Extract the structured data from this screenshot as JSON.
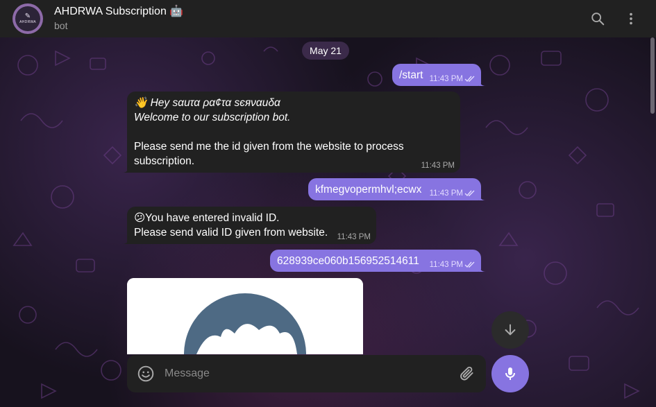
{
  "header": {
    "avatar_text": "AHDRWA",
    "title": "AHDRWA Subscription 🤖",
    "subtitle": "bot",
    "search_icon": "search-icon",
    "menu_icon": "more-vertical-icon"
  },
  "date_separator": "May 21",
  "messages": [
    {
      "direction": "out",
      "text": "/start",
      "time": "11:43 PM"
    },
    {
      "direction": "in",
      "line1": "👋 Hey ѕαиτα ρα¢τα ѕєяναиδα",
      "line2": "Welcome to our subscription bot.",
      "line3": "Please send me the id given from the website to process subscription.",
      "time": "11:43 PM"
    },
    {
      "direction": "out",
      "text": "kfmegvopermhvl;ecwx",
      "time": "11:43 PM"
    },
    {
      "direction": "in",
      "line1": "😕You have entered invalid ID.",
      "line2": "Please send valid ID given from website.",
      "time": "11:43 PM"
    },
    {
      "direction": "out",
      "text": "628939ce060b156952514611",
      "time": "11:43 PM"
    }
  ],
  "composer": {
    "placeholder": "Message",
    "emoji_icon": "emoji-icon",
    "attach_icon": "paperclip-icon",
    "mic_icon": "microphone-icon",
    "scroll_down_icon": "arrow-down-icon"
  },
  "colors": {
    "outgoing_bubble": "#8774e1",
    "incoming_bubble": "#212121",
    "header_bg": "#212121",
    "accent": "#8774e1"
  }
}
